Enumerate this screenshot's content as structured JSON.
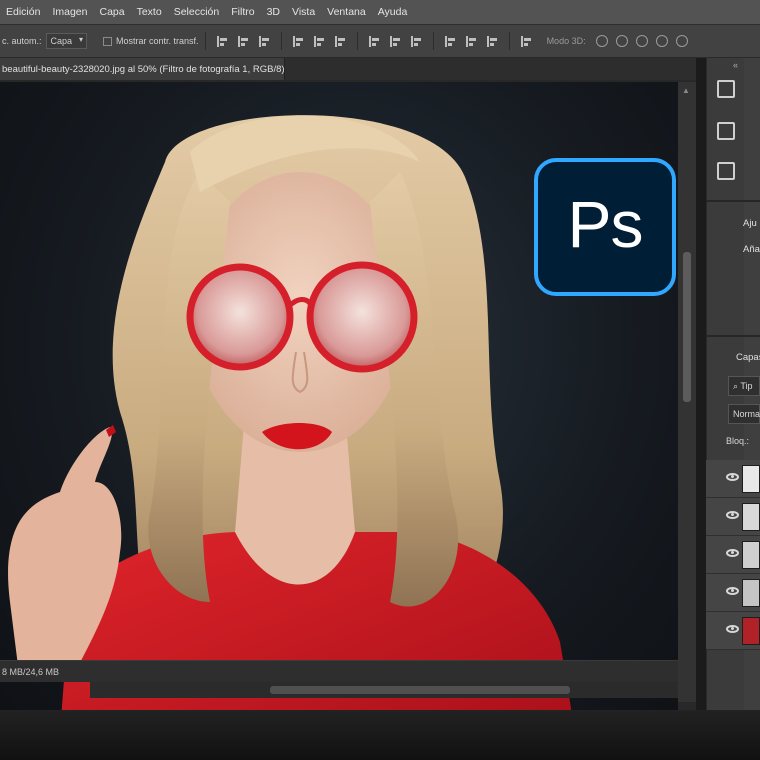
{
  "menu": [
    "Edición",
    "Imagen",
    "Capa",
    "Texto",
    "Selección",
    "Filtro",
    "3D",
    "Vista",
    "Ventana",
    "Ayuda"
  ],
  "options": {
    "auto_select_label": "c. autom.:",
    "auto_select_value": "Capa",
    "transform_label": "Mostrar contr. transf.",
    "mode3d_label": "Modo 3D:"
  },
  "document": {
    "tab_title": "beautiful-beauty-2328020.jpg al 50% (Filtro de fotografía 1, RGB/8) *",
    "tab_close": "×",
    "status": "8 MB/24,6 MB"
  },
  "logo": {
    "text": "Ps"
  },
  "panels": {
    "collapse": "«",
    "adjust_title": "Aju",
    "adjust_sub": "Aña",
    "layers_title": "Capas",
    "kind_filter": "Tip",
    "blend_mode": "Norma",
    "lock_label": "Bloq.:"
  },
  "colors": {
    "ps_blue": "#31a8ff",
    "ps_dark": "#001e36",
    "shirt_red": "#c8161e"
  }
}
